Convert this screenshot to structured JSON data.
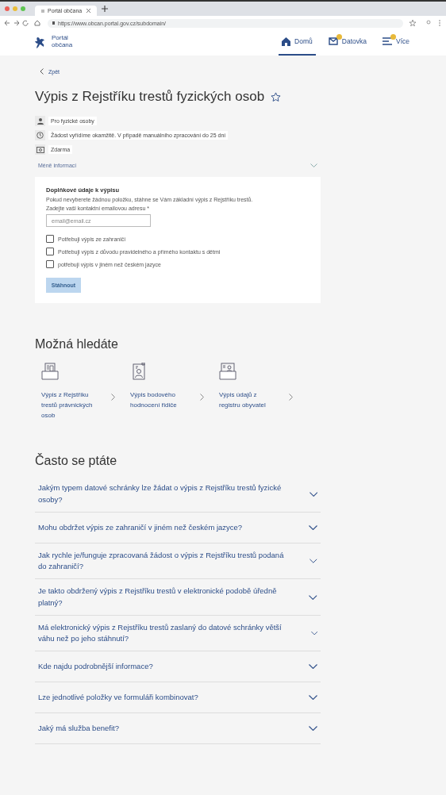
{
  "browser": {
    "tab_title": "Portál občana",
    "url": "https://www.obcan.portal.gov.cz/subdomain/"
  },
  "header": {
    "logo_text": "Portál občana",
    "nav": [
      {
        "label": "Domů",
        "selected": true,
        "badge": false
      },
      {
        "label": "Datovka",
        "selected": false,
        "badge": true
      },
      {
        "label": "Více",
        "selected": false,
        "badge": true
      }
    ]
  },
  "back_link": "Zpět",
  "title": "Výpis z Rejstříku trestů fyzických osob",
  "favorite": false,
  "info": [
    {
      "text": "Pro fyzické osoby"
    },
    {
      "text": "Žádost vyřídíme okamžitě. V případě manuálního zpracování do 25 dní"
    },
    {
      "text": "Zdarma"
    }
  ],
  "less_info": "Méně informací",
  "form": {
    "heading": "Doplňkové údaje k výpisu",
    "note": "Pokud nevyberete žádnou položku, stáhne se Vám základní výpis z Rejstříku trestů.",
    "email_label": "Zadejte vaši kontaktní emailovou adresu *",
    "email_placeholder": "email@email.cz",
    "options": [
      {
        "label": "Potřebuji výpis ze zahraničí",
        "checked": false
      },
      {
        "label": "Potřebuji výpis z důvodu pravidelného a přímého kontaktu s dětmi",
        "checked": false
      },
      {
        "label": "potřebuji výpis v jiném než českém jazyce",
        "checked": false
      }
    ],
    "submit": {
      "label": "Stáhnout",
      "disabled": true
    }
  },
  "suggestions": {
    "heading": "Možná hledáte",
    "items": [
      {
        "label": "Výpis z Rejstříku trestů právnických osob"
      },
      {
        "label": "Výpis bodového hodnocení řidiče"
      },
      {
        "label": "Výpis údajů z registru obyvatel"
      }
    ]
  },
  "faq": {
    "heading": "Často se ptáte",
    "items": [
      {
        "question": "Jakým typem datové schránky lze žádat o výpis z Rejstříku trestů fyzické osoby?",
        "expanded": false
      },
      {
        "question": "Mohu obdržet výpis ze zahraničí v jiném než českém jazyce?",
        "expanded": false
      },
      {
        "question": "Jak rychle je/funguje zpracovaná žádost o výpis z Rejstříku trestů podaná do zahraničí?",
        "expanded": false
      },
      {
        "question": "Je takto obdržený výpis z Rejstříku trestů v elektronické podobě úředně platný?",
        "expanded": false
      },
      {
        "question": "Má elektronický výpis z Rejstříku trestů zaslaný do datové schránky větší váhu než po jeho stáhnutí?",
        "expanded": false
      },
      {
        "question": "Kde najdu podrobnější informace?",
        "expanded": false
      },
      {
        "question": "Lze jednotlivé položky ve formuláři kombinovat?",
        "expanded": false
      },
      {
        "question": "Jaký má služba benefit?",
        "expanded": false
      }
    ]
  }
}
